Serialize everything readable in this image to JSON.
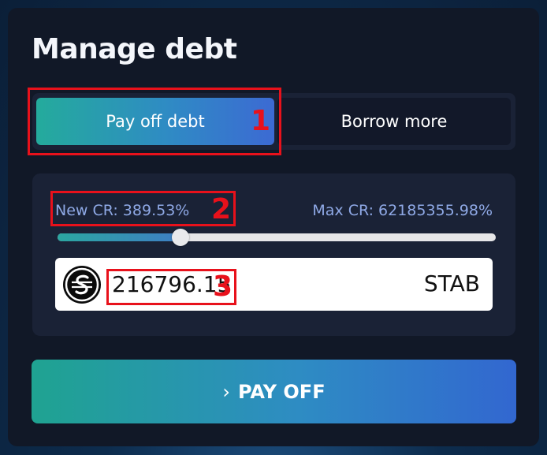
{
  "panel": {
    "title": "Manage debt"
  },
  "tabs": [
    {
      "label": "Pay off debt",
      "active": true
    },
    {
      "label": "Borrow more",
      "active": false
    }
  ],
  "ratios": {
    "new_cr": "New CR: 389.53%",
    "max_cr": "Max CR: 62185355.98%"
  },
  "slider": {
    "value_fraction": 0.28
  },
  "amount": {
    "value": "216796.15",
    "token": "STAB",
    "token_icon": "stab-token-icon"
  },
  "action": {
    "chevron": "›",
    "label": "PAY OFF"
  },
  "annotations": [
    "1",
    "2",
    "3"
  ],
  "colors": {
    "accent_start": "#24ab9c",
    "accent_end": "#3267d0",
    "annotation_red": "#e8111b",
    "panel_bg": "#111827",
    "label_blue": "#8fa9e6"
  }
}
